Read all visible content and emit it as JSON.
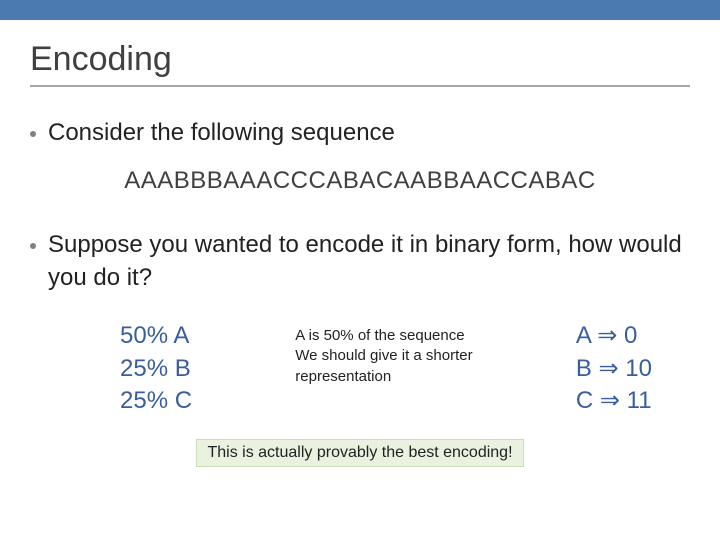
{
  "title": "Encoding",
  "bullet1": "Consider the following sequence",
  "sequence": "AAABBBAAACCCABACAABBAACCABAC",
  "bullet2": "Suppose you wanted to encode it in binary form, how would you do it?",
  "freq": {
    "a": "50% A",
    "b": "25% B",
    "c": "25% C"
  },
  "note": {
    "l1": "A is 50% of the sequence",
    "l2": "We should give it a shorter",
    "l3": "representation"
  },
  "codes": {
    "a_sym": "A",
    "a_code": "0",
    "b_sym": "B",
    "b_code": "10",
    "c_sym": "C",
    "c_code": "11",
    "arrow": "⇒"
  },
  "best": "This is actually provably the best encoding!"
}
